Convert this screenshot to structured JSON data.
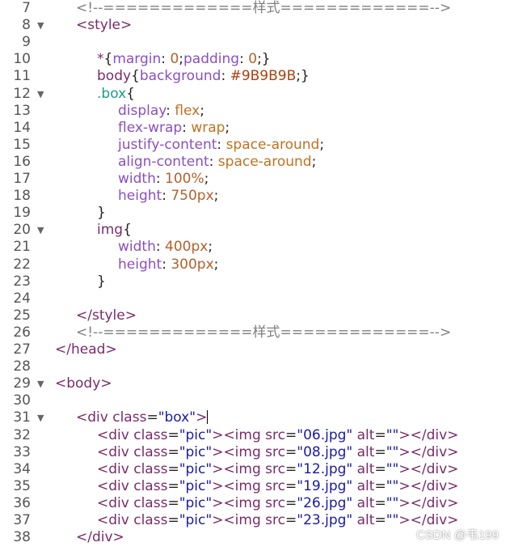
{
  "lines": [
    {
      "n": "7",
      "fold": false,
      "indent": 1,
      "tokens": [
        [
          "comment",
          "<!--=============样式=============-->"
        ]
      ]
    },
    {
      "n": "8",
      "fold": true,
      "indent": 1,
      "tokens": [
        [
          "tag",
          "<style>"
        ]
      ]
    },
    {
      "n": "9",
      "fold": false,
      "indent": 0,
      "tokens": []
    },
    {
      "n": "10",
      "fold": false,
      "indent": 2,
      "tokens": [
        [
          "sel",
          "*"
        ],
        [
          "punc",
          "{"
        ],
        [
          "prop",
          "margin"
        ],
        [
          "punc",
          ": "
        ],
        [
          "num",
          "0"
        ],
        [
          "punc",
          ";"
        ],
        [
          "prop",
          "padding"
        ],
        [
          "punc",
          ": "
        ],
        [
          "num",
          "0"
        ],
        [
          "punc",
          ";}"
        ]
      ]
    },
    {
      "n": "11",
      "fold": false,
      "indent": 2,
      "tokens": [
        [
          "sel",
          "body"
        ],
        [
          "punc",
          "{"
        ],
        [
          "prop",
          "background"
        ],
        [
          "punc",
          ": "
        ],
        [
          "color",
          "#9B9B9B"
        ],
        [
          "punc",
          ";}"
        ]
      ]
    },
    {
      "n": "12",
      "fold": true,
      "indent": 2,
      "tokens": [
        [
          "cls",
          ".box"
        ],
        [
          "punc",
          "{"
        ]
      ]
    },
    {
      "n": "13",
      "fold": false,
      "indent": 3,
      "tokens": [
        [
          "prop",
          "display"
        ],
        [
          "punc",
          ": "
        ],
        [
          "val",
          "flex"
        ],
        [
          "punc",
          ";"
        ]
      ]
    },
    {
      "n": "14",
      "fold": false,
      "indent": 3,
      "tokens": [
        [
          "prop",
          "flex-wrap"
        ],
        [
          "punc",
          ": "
        ],
        [
          "val",
          "wrap"
        ],
        [
          "punc",
          ";"
        ]
      ]
    },
    {
      "n": "15",
      "fold": false,
      "indent": 3,
      "tokens": [
        [
          "prop",
          "justify-content"
        ],
        [
          "punc",
          ": "
        ],
        [
          "val",
          "space-around"
        ],
        [
          "punc",
          ";"
        ]
      ]
    },
    {
      "n": "16",
      "fold": false,
      "indent": 3,
      "tokens": [
        [
          "prop",
          "align-content"
        ],
        [
          "punc",
          ": "
        ],
        [
          "val",
          "space-around"
        ],
        [
          "punc",
          ";"
        ]
      ]
    },
    {
      "n": "17",
      "fold": false,
      "indent": 3,
      "tokens": [
        [
          "prop",
          "width"
        ],
        [
          "punc",
          ": "
        ],
        [
          "num",
          "100%"
        ],
        [
          "punc",
          ";"
        ]
      ]
    },
    {
      "n": "18",
      "fold": false,
      "indent": 3,
      "tokens": [
        [
          "prop",
          "height"
        ],
        [
          "punc",
          ": "
        ],
        [
          "num",
          "750px"
        ],
        [
          "punc",
          ";"
        ]
      ]
    },
    {
      "n": "19",
      "fold": false,
      "indent": 2,
      "tokens": [
        [
          "punc",
          "}"
        ]
      ]
    },
    {
      "n": "20",
      "fold": true,
      "indent": 2,
      "tokens": [
        [
          "sel",
          "img"
        ],
        [
          "punc",
          "{"
        ]
      ]
    },
    {
      "n": "21",
      "fold": false,
      "indent": 3,
      "tokens": [
        [
          "prop",
          "width"
        ],
        [
          "punc",
          ": "
        ],
        [
          "num",
          "400px"
        ],
        [
          "punc",
          ";"
        ]
      ]
    },
    {
      "n": "22",
      "fold": false,
      "indent": 3,
      "tokens": [
        [
          "prop",
          "height"
        ],
        [
          "punc",
          ": "
        ],
        [
          "num",
          "300px"
        ],
        [
          "punc",
          ";"
        ]
      ]
    },
    {
      "n": "23",
      "fold": false,
      "indent": 2,
      "tokens": [
        [
          "punc",
          "}"
        ]
      ]
    },
    {
      "n": "24",
      "fold": false,
      "indent": 0,
      "tokens": []
    },
    {
      "n": "25",
      "fold": false,
      "indent": 1,
      "tokens": [
        [
          "tag",
          "</style>"
        ]
      ]
    },
    {
      "n": "26",
      "fold": false,
      "indent": 1,
      "tokens": [
        [
          "comment",
          "<!--=============样式=============-->"
        ]
      ]
    },
    {
      "n": "27",
      "fold": false,
      "indent": 0,
      "tokens": [
        [
          "tag",
          "</head>"
        ]
      ]
    },
    {
      "n": "28",
      "fold": false,
      "indent": 0,
      "tokens": []
    },
    {
      "n": "29",
      "fold": true,
      "indent": 0,
      "tokens": [
        [
          "tag",
          "<body>"
        ]
      ]
    },
    {
      "n": "30",
      "fold": false,
      "indent": 0,
      "tokens": []
    },
    {
      "n": "31",
      "fold": true,
      "indent": 1,
      "tokens": [
        [
          "tag",
          "<div "
        ],
        [
          "attr",
          "class"
        ],
        [
          "punc",
          "="
        ],
        [
          "str",
          "\"box\""
        ],
        [
          "tag",
          ">"
        ],
        [
          "cursor",
          ""
        ]
      ]
    },
    {
      "n": "32",
      "fold": false,
      "indent": 2,
      "tokens": [
        [
          "tag",
          "<div "
        ],
        [
          "attr",
          "class"
        ],
        [
          "punc",
          "="
        ],
        [
          "str",
          "\"pic\""
        ],
        [
          "tag",
          ">"
        ],
        [
          "tag",
          "<img "
        ],
        [
          "attr",
          "src"
        ],
        [
          "punc",
          "="
        ],
        [
          "str",
          "\"06.jpg\""
        ],
        [
          "attr",
          " alt"
        ],
        [
          "punc",
          "="
        ],
        [
          "str",
          "\"\""
        ],
        [
          "tag",
          ">"
        ],
        [
          "tag",
          "</div>"
        ]
      ]
    },
    {
      "n": "33",
      "fold": false,
      "indent": 2,
      "tokens": [
        [
          "tag",
          "<div "
        ],
        [
          "attr",
          "class"
        ],
        [
          "punc",
          "="
        ],
        [
          "str",
          "\"pic\""
        ],
        [
          "tag",
          ">"
        ],
        [
          "tag",
          "<img "
        ],
        [
          "attr",
          "src"
        ],
        [
          "punc",
          "="
        ],
        [
          "str",
          "\"08.jpg\""
        ],
        [
          "attr",
          " alt"
        ],
        [
          "punc",
          "="
        ],
        [
          "str",
          "\"\""
        ],
        [
          "tag",
          ">"
        ],
        [
          "tag",
          "</div>"
        ]
      ]
    },
    {
      "n": "34",
      "fold": false,
      "indent": 2,
      "tokens": [
        [
          "tag",
          "<div "
        ],
        [
          "attr",
          "class"
        ],
        [
          "punc",
          "="
        ],
        [
          "str",
          "\"pic\""
        ],
        [
          "tag",
          ">"
        ],
        [
          "tag",
          "<img "
        ],
        [
          "attr",
          "src"
        ],
        [
          "punc",
          "="
        ],
        [
          "str",
          "\"12.jpg\""
        ],
        [
          "attr",
          " alt"
        ],
        [
          "punc",
          "="
        ],
        [
          "str",
          "\"\""
        ],
        [
          "tag",
          ">"
        ],
        [
          "tag",
          "</div>"
        ]
      ]
    },
    {
      "n": "35",
      "fold": false,
      "indent": 2,
      "tokens": [
        [
          "tag",
          "<div "
        ],
        [
          "attr",
          "class"
        ],
        [
          "punc",
          "="
        ],
        [
          "str",
          "\"pic\""
        ],
        [
          "tag",
          ">"
        ],
        [
          "tag",
          "<img "
        ],
        [
          "attr",
          "src"
        ],
        [
          "punc",
          "="
        ],
        [
          "str",
          "\"19.jpg\""
        ],
        [
          "attr",
          " alt"
        ],
        [
          "punc",
          "="
        ],
        [
          "str",
          "\"\""
        ],
        [
          "tag",
          ">"
        ],
        [
          "tag",
          "</div>"
        ]
      ]
    },
    {
      "n": "36",
      "fold": false,
      "indent": 2,
      "tokens": [
        [
          "tag",
          "<div "
        ],
        [
          "attr",
          "class"
        ],
        [
          "punc",
          "="
        ],
        [
          "str",
          "\"pic\""
        ],
        [
          "tag",
          ">"
        ],
        [
          "tag",
          "<img "
        ],
        [
          "attr",
          "src"
        ],
        [
          "punc",
          "="
        ],
        [
          "str",
          "\"26.jpg\""
        ],
        [
          "attr",
          " alt"
        ],
        [
          "punc",
          "="
        ],
        [
          "str",
          "\"\""
        ],
        [
          "tag",
          ">"
        ],
        [
          "tag",
          "</div>"
        ]
      ]
    },
    {
      "n": "37",
      "fold": false,
      "indent": 2,
      "tokens": [
        [
          "tag",
          "<div "
        ],
        [
          "attr",
          "class"
        ],
        [
          "punc",
          "="
        ],
        [
          "str",
          "\"pic\""
        ],
        [
          "tag",
          ">"
        ],
        [
          "tag",
          "<img "
        ],
        [
          "attr",
          "src"
        ],
        [
          "punc",
          "="
        ],
        [
          "str",
          "\"23.jpg\""
        ],
        [
          "attr",
          " alt"
        ],
        [
          "punc",
          "="
        ],
        [
          "str",
          "\"\""
        ],
        [
          "tag",
          ">"
        ],
        [
          "tag",
          "</div>"
        ]
      ]
    },
    {
      "n": "38",
      "fold": false,
      "indent": 1,
      "tokens": [
        [
          "tag",
          "</div>"
        ]
      ]
    }
  ],
  "fold_icon": "fold-triangle-icon",
  "watermark": "CSDN @韦199"
}
